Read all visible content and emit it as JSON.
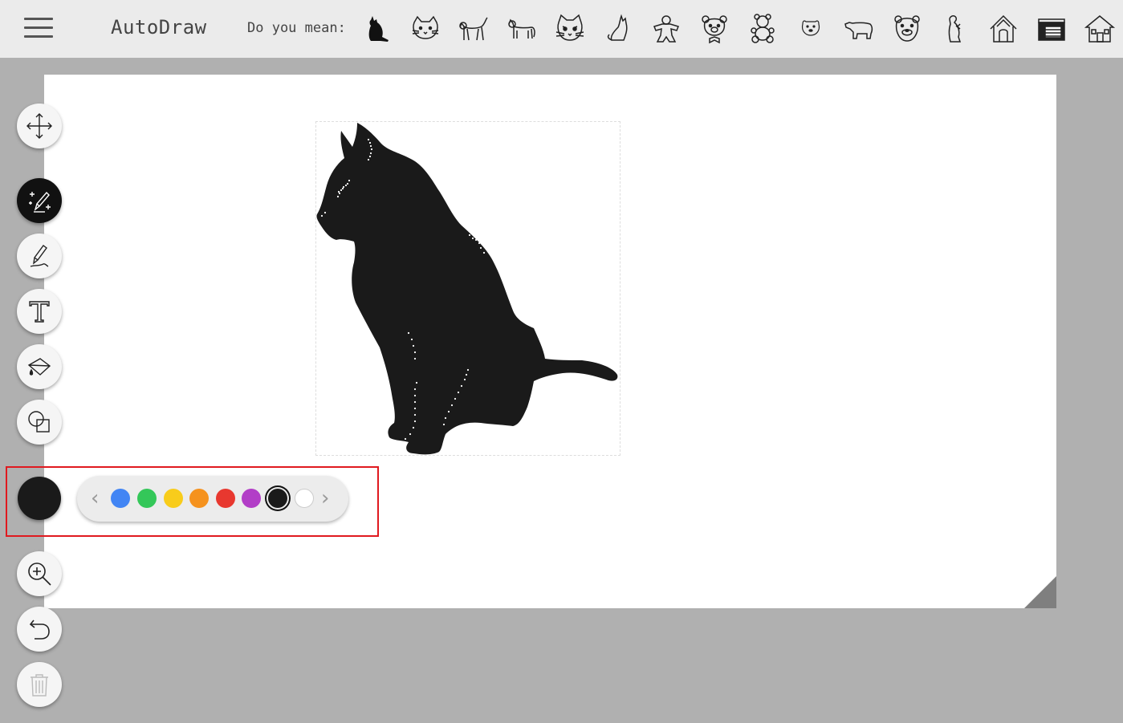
{
  "header": {
    "app_title": "AutoDraw",
    "suggest_label": "Do you mean:",
    "suggestions": [
      "cat-silhouette",
      "cat-face",
      "cat-walking",
      "cat-walking-2",
      "cat-face-2",
      "cat-sitting",
      "gingerbread",
      "bear-bow",
      "teddy-bear",
      "polar-bear-face",
      "polar-bear",
      "bear-face",
      "meerkat",
      "house",
      "barn",
      "house-2"
    ]
  },
  "tools": [
    "move",
    "autodraw",
    "draw",
    "type",
    "fill",
    "shape",
    "zoom",
    "undo",
    "delete"
  ],
  "palette": {
    "current_color": "#1a1a1a",
    "colors": [
      "#4285f4",
      "#34c759",
      "#f8cc1b",
      "#f5921e",
      "#e8382f",
      "#b23ec7",
      "#1a1a1a",
      "#ffffff"
    ],
    "selected_index": 6
  }
}
